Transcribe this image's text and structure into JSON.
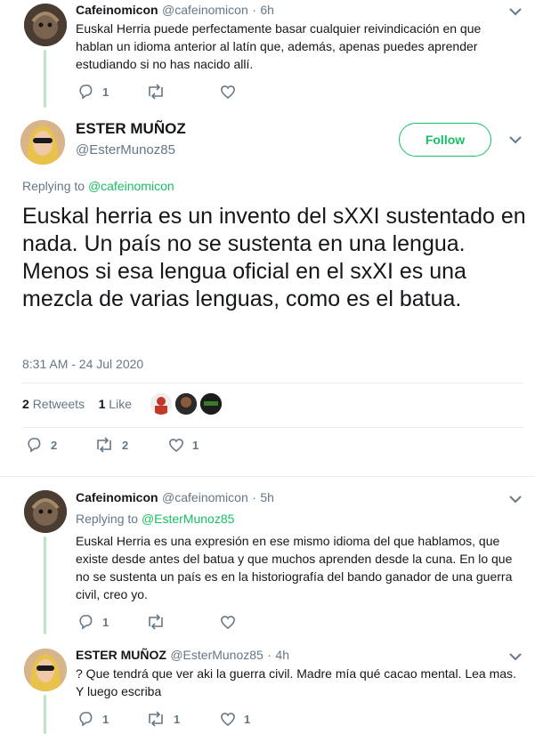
{
  "tweet1": {
    "name": "Cafeinomicon",
    "handle": "@cafeinomicon",
    "sep": "·",
    "time": "6h",
    "text": "Euskal Herria puede perfectamente basar cualquier reivindicación en que hablan un idioma anterior al latín que, además, apenas puedes aprender estudiando si no has nacido allí.",
    "replies": "1"
  },
  "main": {
    "name": "ESTER MUÑOZ",
    "handle": "@EsterMunoz85",
    "follow_label": "Follow",
    "replying_prefix": "Replying to",
    "replying_handle": "@cafeinomicon",
    "text": "Euskal herria es un invento del sXXI sustentado en nada. Un país no se sustenta en una lengua. Menos si esa lengua oficial en el sxXI es una mezcla de varias lenguas, como es el batua.",
    "timestamp": "8:31 AM - 24 Jul 2020",
    "retweets_count": "2",
    "retweets_label": "Retweets",
    "likes_count": "1",
    "likes_label": "Like",
    "reply_count": "2",
    "retweet_count": "2",
    "like_count": "1"
  },
  "tweet3": {
    "name": "Cafeinomicon",
    "handle": "@cafeinomicon",
    "sep": "·",
    "time": "5h",
    "replying_prefix": "Replying to",
    "replying_handle": "@EsterMunoz85",
    "text": "Euskal Herria es una expresión en ese mismo idioma del que hablamos, que existe desde antes del batua y que muchos aprenden desde la cuna. En lo que no se sustenta un país es en la historiografía del bando ganador de una guerra civil, creo yo.",
    "replies": "1"
  },
  "tweet4": {
    "name": "ESTER MUÑOZ",
    "handle": "@EsterMunoz85",
    "sep": "·",
    "time": "4h",
    "text": "? Que tendrá que ver aki la guerra civil. Madre mía qué cacao mental. Lea mas. Y luego escriba",
    "replies": "1",
    "retweets": "1",
    "likes": "1"
  },
  "colors": {
    "accent": "#17bf63",
    "thread_line": "#b9e6c4",
    "muted": "#657786"
  },
  "icons": [
    "reply-icon",
    "retweet-icon",
    "like-icon",
    "chevron-down-icon"
  ]
}
